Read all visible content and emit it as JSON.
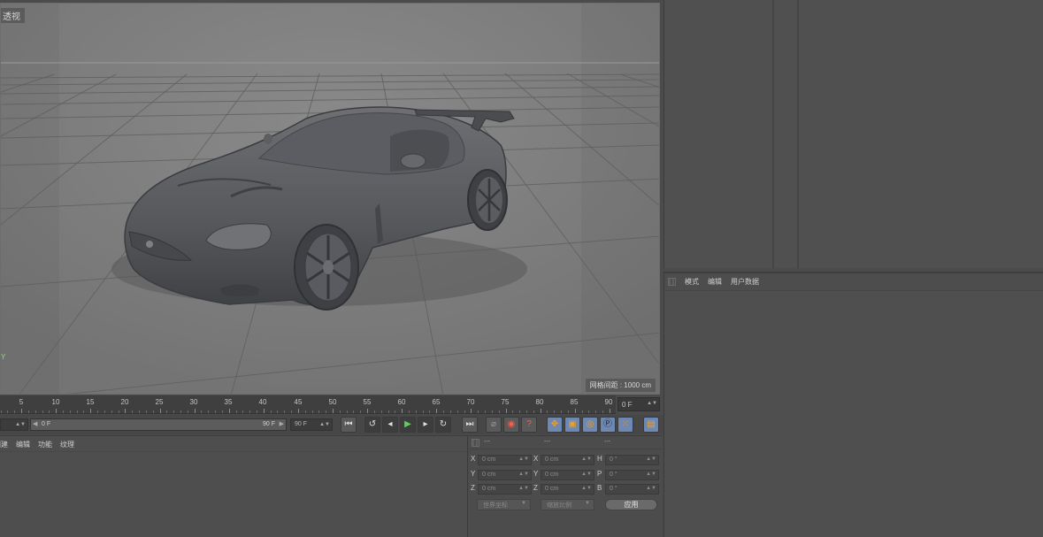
{
  "viewport": {
    "label": "透视",
    "grid_info": "网格间距 : 1000 cm",
    "axis_y": "Y"
  },
  "attributes": {
    "menu": [
      "模式",
      "编辑",
      "用户数据"
    ]
  },
  "timeline": {
    "ticks": [
      "5",
      "10",
      "15",
      "20",
      "25",
      "30",
      "35",
      "40",
      "45",
      "50",
      "55",
      "60",
      "65",
      "70",
      "75",
      "80",
      "85",
      "90"
    ],
    "current_frame": "0 F",
    "slider_start": "0 F",
    "slider_end": "90 F",
    "end_frame": "90 F"
  },
  "materials": {
    "menu": [
      "创建",
      "编辑",
      "功能",
      "纹理"
    ]
  },
  "coordinates": {
    "header": [
      "---",
      "---",
      "---"
    ],
    "rows": [
      {
        "a": "X",
        "av": "0 cm",
        "b": "X",
        "bv": "0 cm",
        "c": "H",
        "cv": "0 °"
      },
      {
        "a": "Y",
        "av": "0 cm",
        "b": "Y",
        "bv": "0 cm",
        "c": "P",
        "cv": "0 °"
      },
      {
        "a": "Z",
        "av": "0 cm",
        "b": "Z",
        "bv": "0 cm",
        "c": "B",
        "cv": "0 °"
      }
    ],
    "mode_select": "世界坐标",
    "scale_select": "缩放比例",
    "apply_label": "应用"
  }
}
